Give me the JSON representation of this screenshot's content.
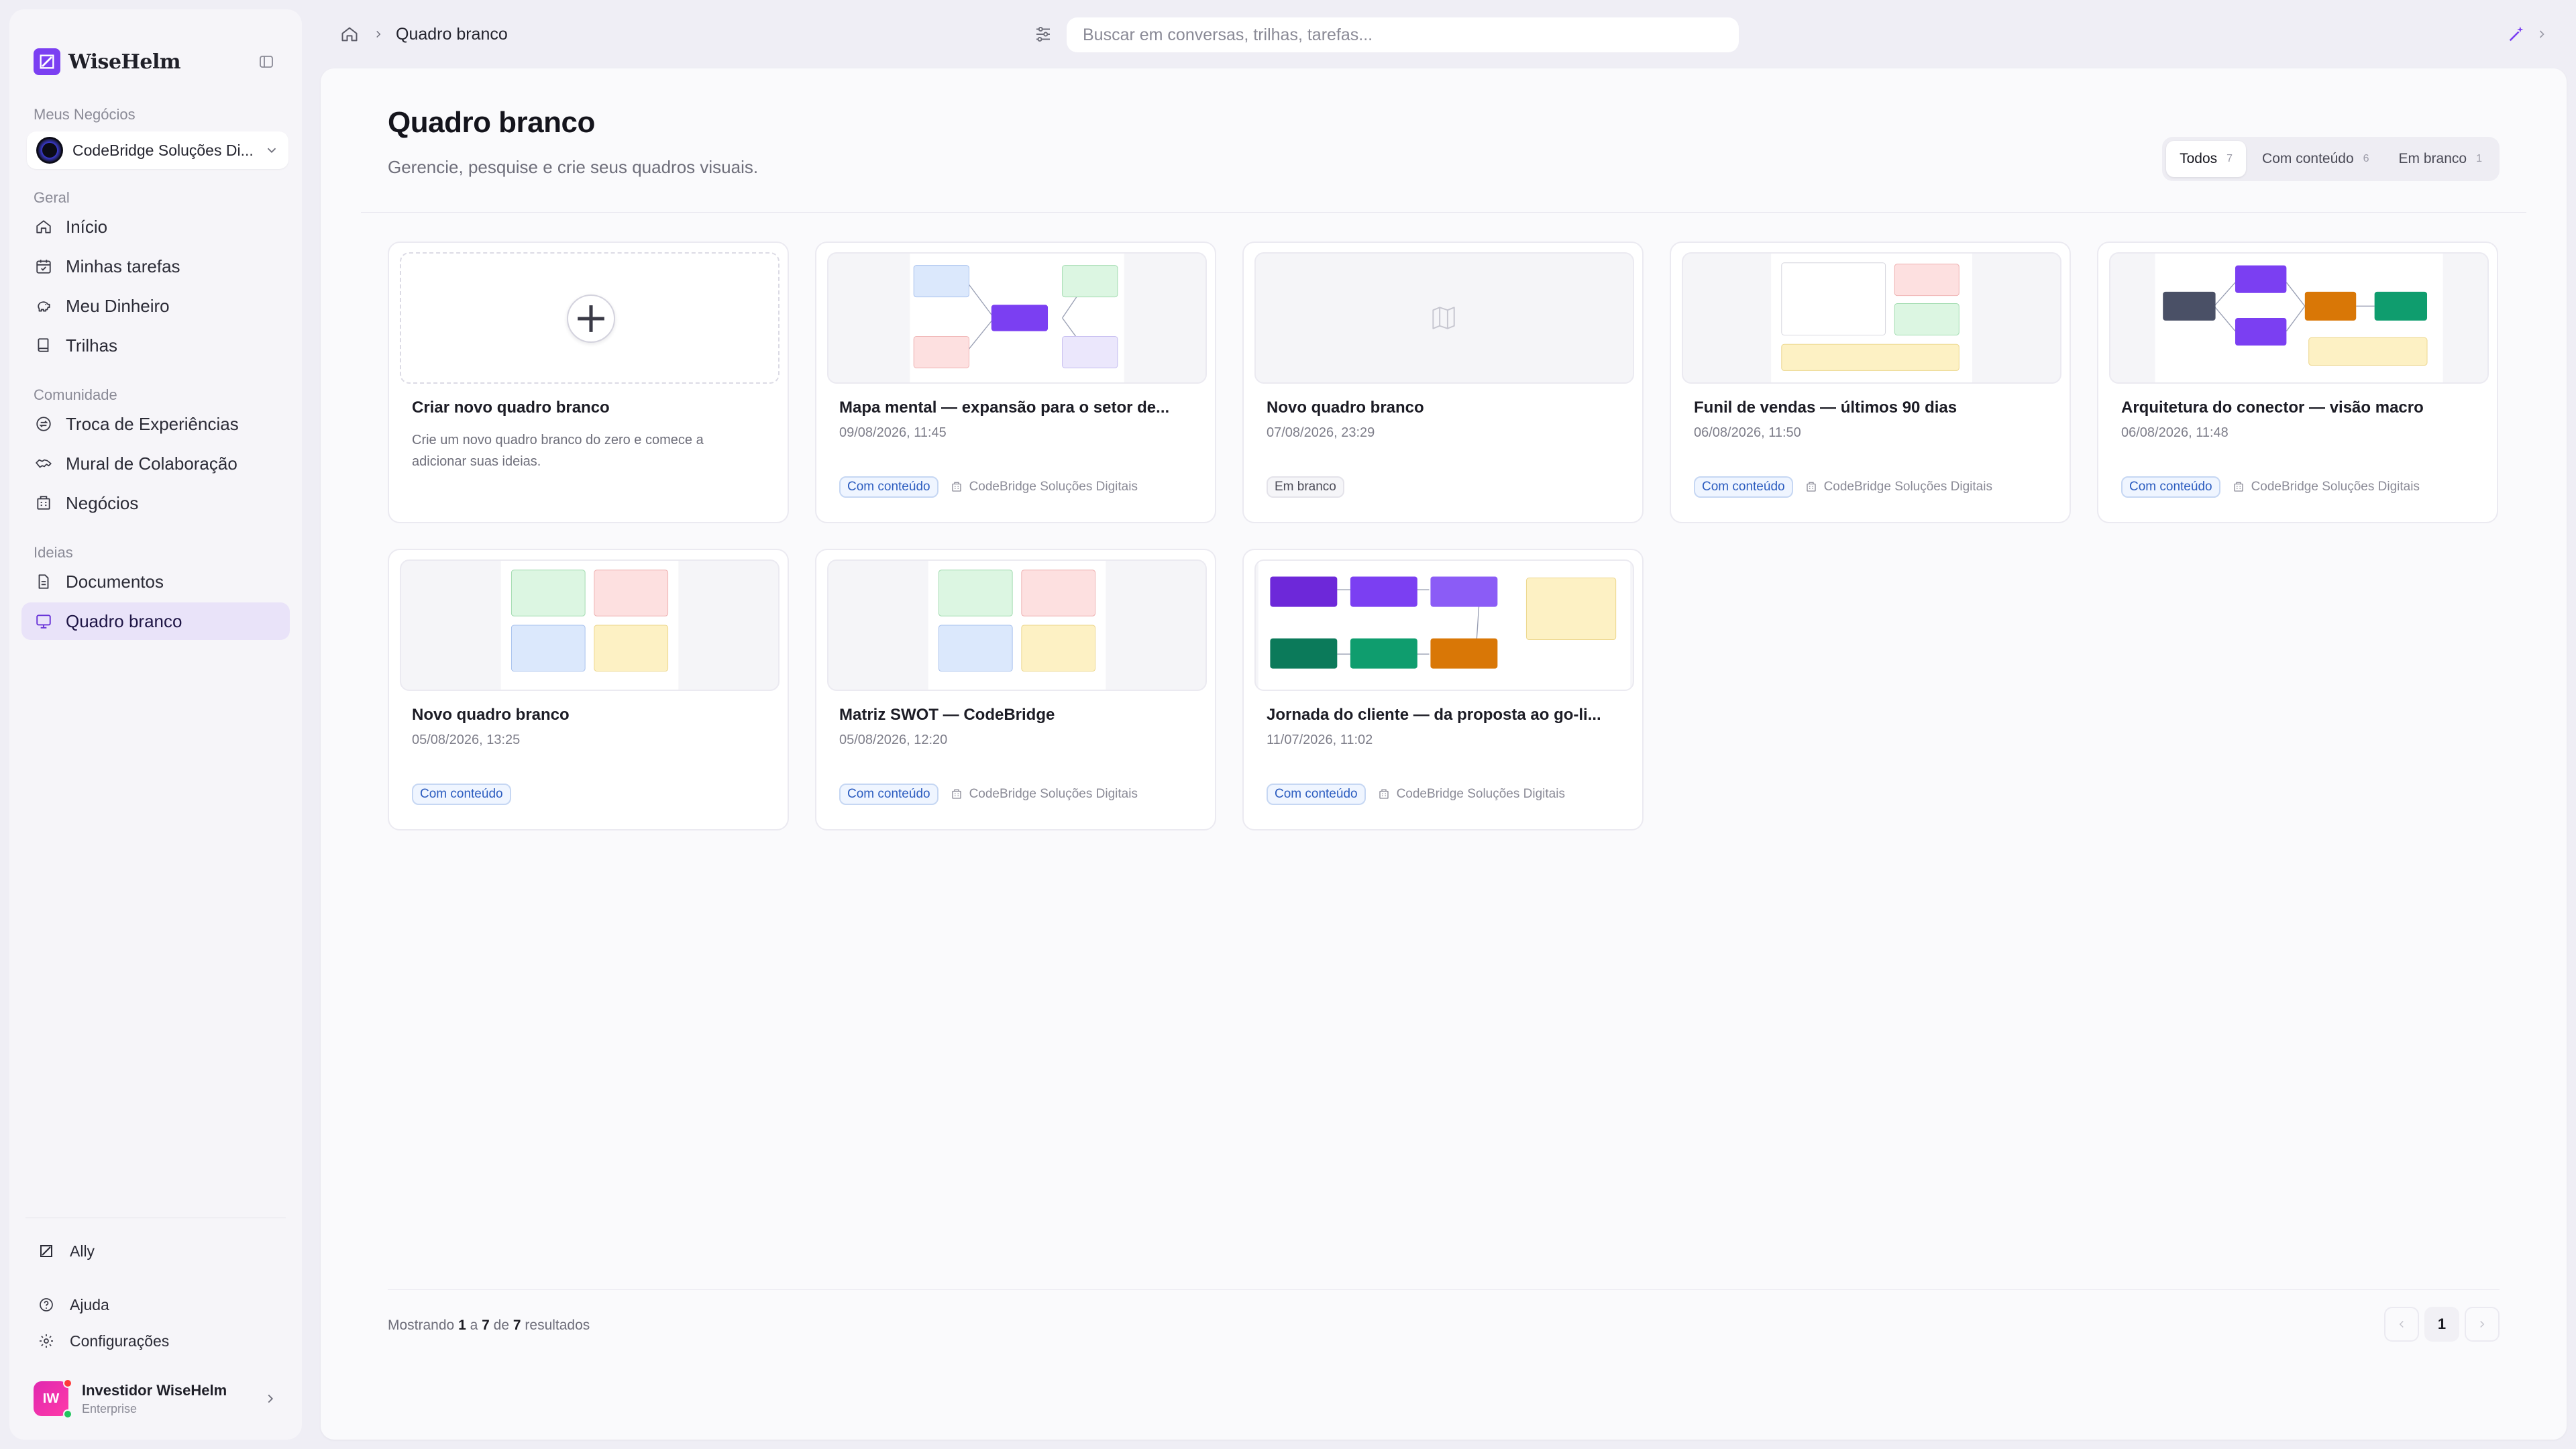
{
  "app": {
    "name": "WiseHelm"
  },
  "sidebar": {
    "my_business_label": "Meus Negócios",
    "business_name": "CodeBridge Soluções Di...",
    "sections": {
      "geral": "Geral",
      "comunidade": "Comunidade",
      "ideias": "Ideias"
    },
    "items": {
      "inicio": "Início",
      "tarefas": "Minhas tarefas",
      "dinheiro": "Meu Dinheiro",
      "trilhas": "Trilhas",
      "troca": "Troca de Experiências",
      "mural": "Mural de Colaboração",
      "negocios": "Negócios",
      "documentos": "Documentos",
      "quadro": "Quadro branco"
    },
    "bottom": {
      "ally": "Ally",
      "ajuda": "Ajuda",
      "config": "Configurações"
    },
    "user": {
      "initials": "IW",
      "name": "Investidor WiseHelm",
      "plan": "Enterprise"
    }
  },
  "topbar": {
    "breadcrumb_current": "Quadro branco",
    "search_placeholder": "Buscar em conversas, trilhas, tarefas..."
  },
  "page": {
    "title": "Quadro branco",
    "subtitle": "Gerencie, pesquise e crie seus quadros visuais.",
    "filters": [
      {
        "label": "Todos",
        "count": "7"
      },
      {
        "label": "Com conteúdo",
        "count": "6"
      },
      {
        "label": "Em branco",
        "count": "1"
      }
    ]
  },
  "create_card": {
    "title": "Criar novo quadro branco",
    "description": "Crie um novo quadro branco do zero e comece a adicionar suas ideias."
  },
  "boards": [
    {
      "title": "Mapa mental — expansão para o setor de...",
      "date": "09/08/2026, 11:45",
      "tag": "Com conteúdo",
      "org": "CodeBridge Soluções Digitais"
    },
    {
      "title": "Novo quadro branco",
      "date": "07/08/2026, 23:29",
      "tag": "Em branco",
      "org": ""
    },
    {
      "title": "Funil de vendas — últimos 90 dias",
      "date": "06/08/2026, 11:50",
      "tag": "Com conteúdo",
      "org": "CodeBridge Soluções Digitais"
    },
    {
      "title": "Arquitetura do conector — visão macro",
      "date": "06/08/2026, 11:48",
      "tag": "Com conteúdo",
      "org": "CodeBridge Soluções Digitais"
    },
    {
      "title": "Novo quadro branco",
      "date": "05/08/2026, 13:25",
      "tag": "Com conteúdo",
      "org": ""
    },
    {
      "title": "Matriz SWOT — CodeBridge",
      "date": "05/08/2026, 12:20",
      "tag": "Com conteúdo",
      "org": "CodeBridge Soluções Digitais"
    },
    {
      "title": "Jornada do cliente — da proposta ao go-li...",
      "date": "11/07/2026, 11:02",
      "tag": "Com conteúdo",
      "org": "CodeBridge Soluções Digitais"
    }
  ],
  "footer": {
    "showing_prefix": "Mostrando",
    "from": "1",
    "to_word": "a",
    "to": "7",
    "of_word": "de",
    "total": "7",
    "suffix": "resultados",
    "current_page": "1"
  },
  "colors": {
    "accent": "#7b3ff2",
    "active_nav_bg": "#e9e3f9",
    "tag_blue": "#2a5bbf"
  }
}
